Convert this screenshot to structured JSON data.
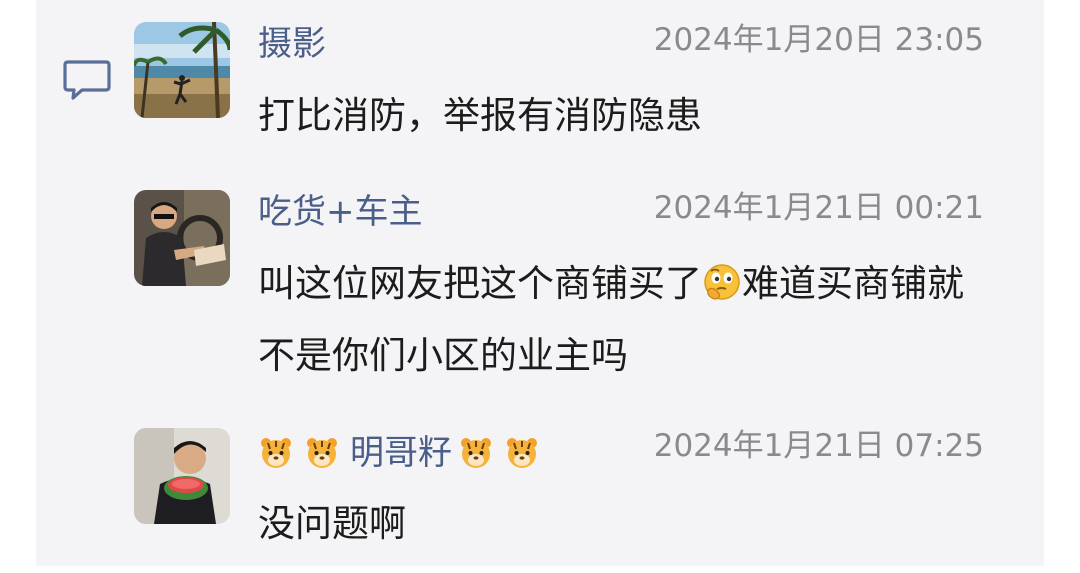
{
  "comments": [
    {
      "username": "摄影",
      "timestamp": "2024年1月20日 23:05",
      "text": "打比消防，举报有消防隐患"
    },
    {
      "username": "吃货+车主",
      "timestamp": "2024年1月21日 00:21",
      "text_before_emoji": "叫这位网友把这个商铺买了",
      "emoji_name": "thinking-face",
      "text_after_emoji": "难道买商铺就不是你们小区的业主吗"
    },
    {
      "username": "明哥籽",
      "name_emoji": "tiger-face",
      "timestamp": "2024年1月21日 07:25",
      "text": "没问题啊"
    }
  ],
  "colors": {
    "panel_background": "#f4f4f6",
    "username": "#4a5e88",
    "timestamp": "#8a8a8e",
    "text": "#1c1c1c",
    "icon_stroke": "#5a6f98"
  },
  "icons": {
    "comment": "comment-bubble-icon"
  }
}
